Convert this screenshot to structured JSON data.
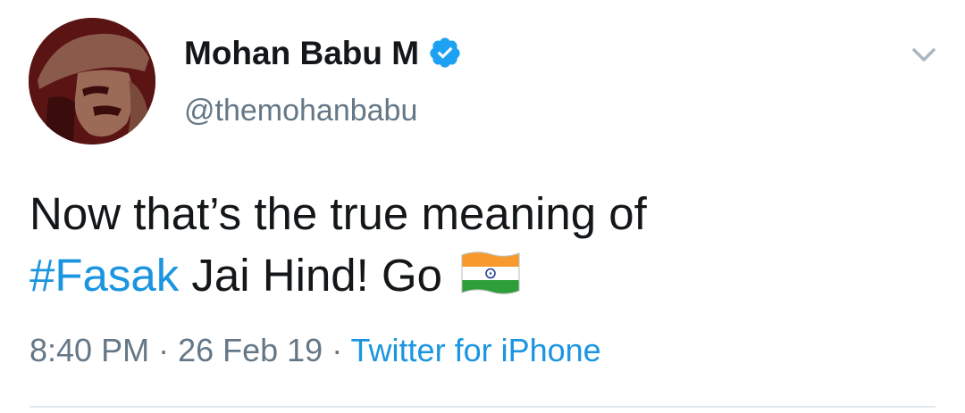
{
  "tweet": {
    "display_name": "Mohan Babu M",
    "handle": "@themohanbabu",
    "verified_icon": "verified-badge-icon",
    "menu_icon": "chevron-down-icon",
    "text_line1": "Now that’s the true meaning of",
    "hashtag": "#Fasak",
    "text_line2": " Jai Hind! Go ",
    "flag_icon": "india-flag-icon",
    "time": "8:40 PM",
    "separator": " · ",
    "date": "26 Feb 19",
    "source": "Twitter for iPhone"
  },
  "colors": {
    "text": "#14171a",
    "secondary": "#657786",
    "link": "#1b95e0",
    "verified": "#1da1f2",
    "divider": "#e1e8ed",
    "avatar_bg": "#5a1414"
  }
}
